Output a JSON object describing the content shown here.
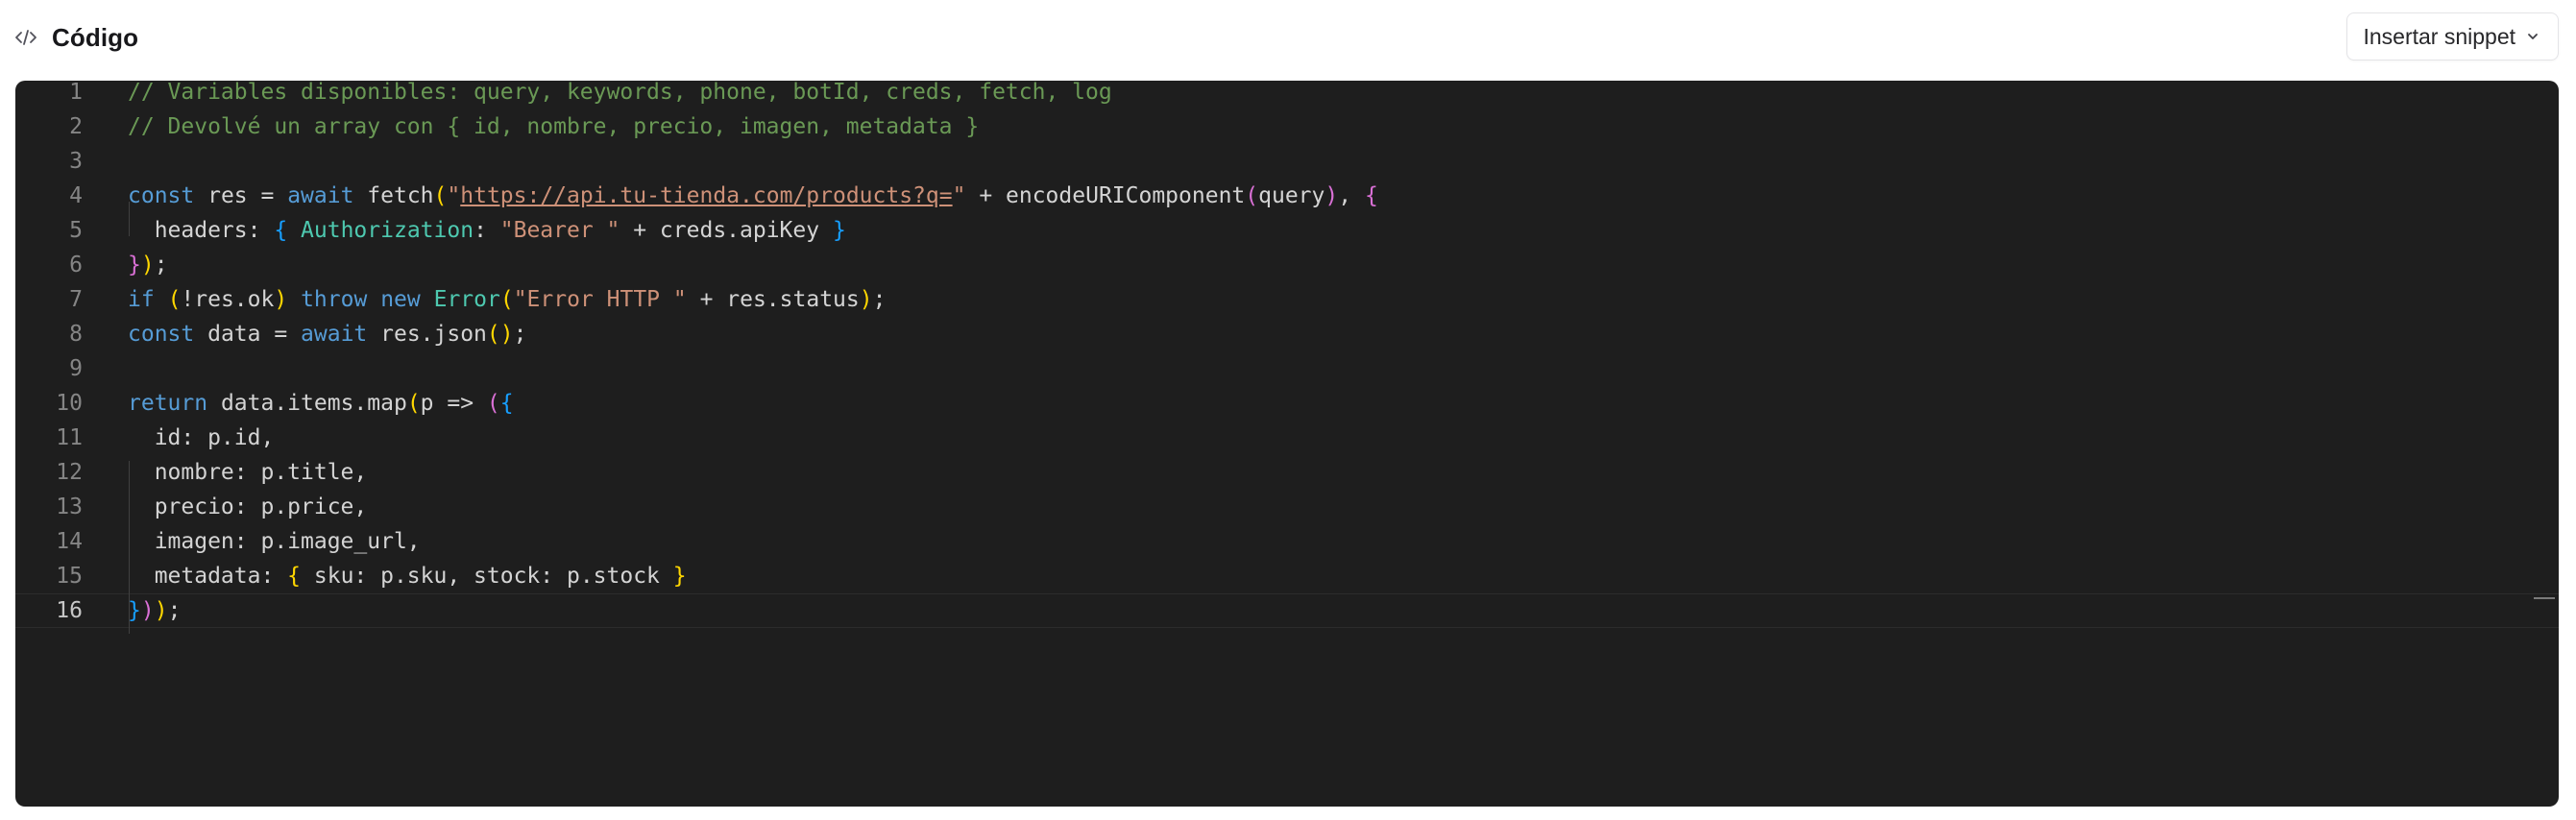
{
  "header": {
    "title": "Código",
    "icon": "code-icon",
    "snippet_button_label": "Insertar snippet"
  },
  "editor": {
    "active_line": 16,
    "lines": [
      {
        "n": "1",
        "tokens": [
          {
            "t": "// Variables disponibles: query, keywords, phone, botId, creds, fetch, log",
            "c": "c-comment"
          }
        ]
      },
      {
        "n": "2",
        "tokens": [
          {
            "t": "// Devolvé un array con { id, nombre, precio, imagen, metadata }",
            "c": "c-comment"
          }
        ]
      },
      {
        "n": "3",
        "tokens": []
      },
      {
        "n": "4",
        "tokens": [
          {
            "t": "const",
            "c": "c-kw"
          },
          {
            "t": " res = ",
            "c": "c-txt"
          },
          {
            "t": "await",
            "c": "c-kw"
          },
          {
            "t": " fetch",
            "c": "c-txt"
          },
          {
            "t": "(",
            "c": "b1"
          },
          {
            "t": "\"",
            "c": "c-str"
          },
          {
            "t": "https://api.tu-tienda.com/products?q=",
            "c": "c-url"
          },
          {
            "t": "\"",
            "c": "c-str"
          },
          {
            "t": " + encodeURIComponent",
            "c": "c-txt"
          },
          {
            "t": "(",
            "c": "b2"
          },
          {
            "t": "query",
            "c": "c-txt"
          },
          {
            "t": ")",
            "c": "b2"
          },
          {
            "t": ", ",
            "c": "c-txt"
          },
          {
            "t": "{",
            "c": "b2"
          }
        ]
      },
      {
        "n": "5",
        "tokens": [
          {
            "t": "  headers: ",
            "c": "c-txt"
          },
          {
            "t": "{",
            "c": "b3"
          },
          {
            "t": " ",
            "c": "c-txt"
          },
          {
            "t": "Authorization",
            "c": "c-type"
          },
          {
            "t": ": ",
            "c": "c-txt"
          },
          {
            "t": "\"Bearer \"",
            "c": "c-str"
          },
          {
            "t": " + creds.apiKey ",
            "c": "c-txt"
          },
          {
            "t": "}",
            "c": "b3"
          }
        ]
      },
      {
        "n": "6",
        "tokens": [
          {
            "t": "}",
            "c": "b2"
          },
          {
            "t": ")",
            "c": "b1"
          },
          {
            "t": ";",
            "c": "c-txt"
          }
        ]
      },
      {
        "n": "7",
        "tokens": [
          {
            "t": "if",
            "c": "c-kw"
          },
          {
            "t": " ",
            "c": "c-txt"
          },
          {
            "t": "(",
            "c": "b1"
          },
          {
            "t": "!res.ok",
            "c": "c-txt"
          },
          {
            "t": ")",
            "c": "b1"
          },
          {
            "t": " ",
            "c": "c-txt"
          },
          {
            "t": "throw",
            "c": "c-kw"
          },
          {
            "t": " ",
            "c": "c-txt"
          },
          {
            "t": "new",
            "c": "c-kw"
          },
          {
            "t": " ",
            "c": "c-txt"
          },
          {
            "t": "Error",
            "c": "c-type"
          },
          {
            "t": "(",
            "c": "b1"
          },
          {
            "t": "\"Error HTTP \"",
            "c": "c-str"
          },
          {
            "t": " + res.status",
            "c": "c-txt"
          },
          {
            "t": ")",
            "c": "b1"
          },
          {
            "t": ";",
            "c": "c-txt"
          }
        ]
      },
      {
        "n": "8",
        "tokens": [
          {
            "t": "const",
            "c": "c-kw"
          },
          {
            "t": " data = ",
            "c": "c-txt"
          },
          {
            "t": "await",
            "c": "c-kw"
          },
          {
            "t": " res.json",
            "c": "c-txt"
          },
          {
            "t": "()",
            "c": "b1"
          },
          {
            "t": ";",
            "c": "c-txt"
          }
        ]
      },
      {
        "n": "9",
        "tokens": []
      },
      {
        "n": "10",
        "tokens": [
          {
            "t": "return",
            "c": "c-kw"
          },
          {
            "t": " data.items.map",
            "c": "c-txt"
          },
          {
            "t": "(",
            "c": "b1"
          },
          {
            "t": "p => ",
            "c": "c-txt"
          },
          {
            "t": "(",
            "c": "b2"
          },
          {
            "t": "{",
            "c": "b3"
          }
        ]
      },
      {
        "n": "11",
        "tokens": [
          {
            "t": "  id: p.id,",
            "c": "c-txt"
          }
        ]
      },
      {
        "n": "12",
        "tokens": [
          {
            "t": "  nombre: p.title,",
            "c": "c-txt"
          }
        ]
      },
      {
        "n": "13",
        "tokens": [
          {
            "t": "  precio: p.price,",
            "c": "c-txt"
          }
        ]
      },
      {
        "n": "14",
        "tokens": [
          {
            "t": "  imagen: p.image_url,",
            "c": "c-txt"
          }
        ]
      },
      {
        "n": "15",
        "tokens": [
          {
            "t": "  metadata: ",
            "c": "c-txt"
          },
          {
            "t": "{",
            "c": "b1"
          },
          {
            "t": " sku: p.sku, stock: p.stock ",
            "c": "c-txt"
          },
          {
            "t": "}",
            "c": "b1"
          }
        ]
      },
      {
        "n": "16",
        "tokens": [
          {
            "t": "}",
            "c": "b3"
          },
          {
            "t": ")",
            "c": "b2"
          },
          {
            "t": ")",
            "c": "b1"
          },
          {
            "t": ";",
            "c": "c-txt"
          }
        ]
      }
    ]
  }
}
